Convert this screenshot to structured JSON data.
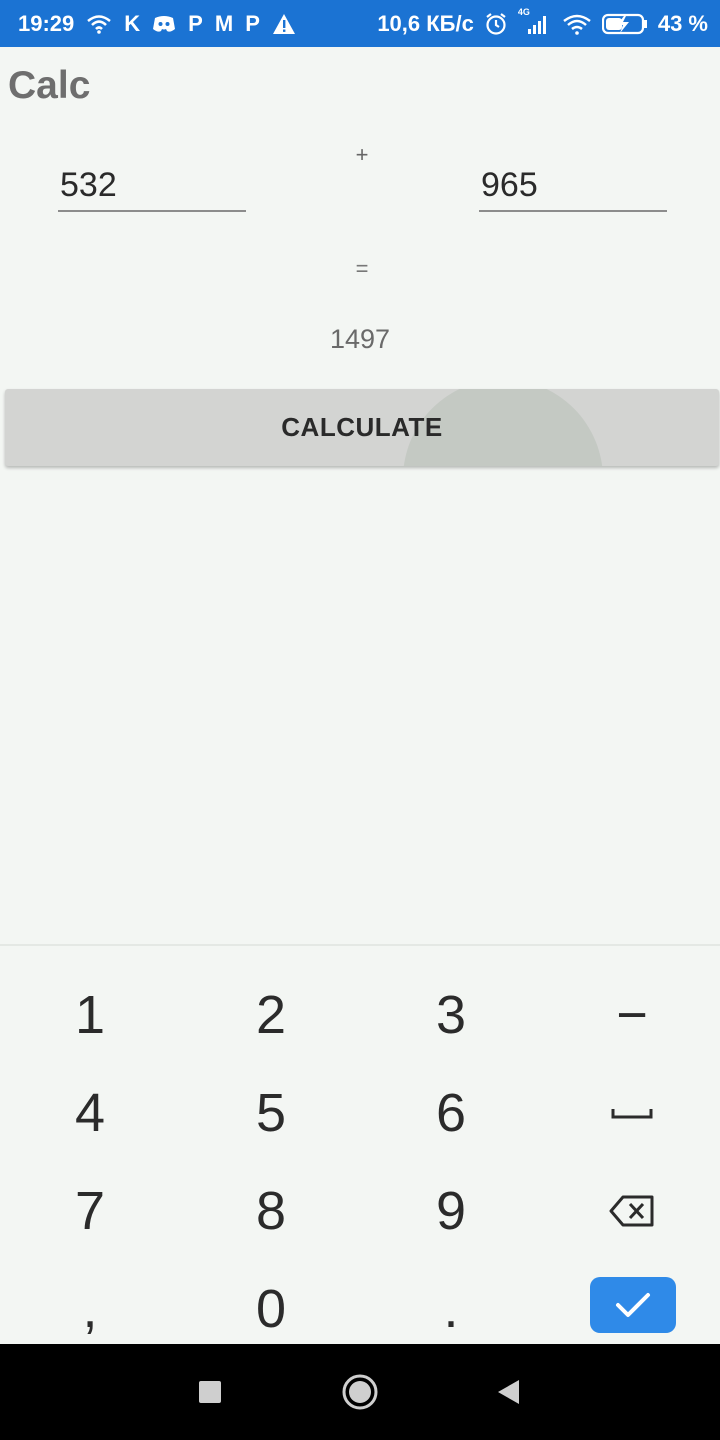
{
  "status_bar": {
    "time": "19:29",
    "network_speed": "10,6 КБ/с",
    "network_type": "4G",
    "battery": "43 %",
    "left_icons": [
      "wifi-icon",
      "k-icon",
      "discord-icon",
      "p-icon",
      "gmail-icon",
      "p-icon",
      "warning-icon"
    ],
    "right_icons": [
      "alarm-icon",
      "signal-icon",
      "wifi-icon",
      "battery-charging-icon"
    ],
    "k_glyph": "K",
    "p_glyph": "P",
    "m_glyph": "M",
    "colors": {
      "background": "#1b73d3",
      "foreground": "#ffffff"
    }
  },
  "app": {
    "title": "Calc",
    "field_a_value": "532",
    "field_b_value": "965",
    "operator": "+",
    "equals": "=",
    "result": "1497",
    "calculate_label": "CALCULATE",
    "colors": {
      "button": "#d3d4d2",
      "background": "#f3f6f3"
    }
  },
  "keyboard": {
    "keys": [
      [
        "1",
        "2",
        "3",
        "−"
      ],
      [
        "4",
        "5",
        "6",
        "space"
      ],
      [
        "7",
        "8",
        "9",
        "backspace"
      ],
      [
        ",",
        "0",
        ".",
        "done"
      ]
    ],
    "labels": {
      "k1": "1",
      "k2": "2",
      "k3": "3",
      "minus": "−",
      "k4": "4",
      "k5": "5",
      "k6": "6",
      "k7": "7",
      "k8": "8",
      "k9": "9",
      "comma": ",",
      "k0": "0",
      "dot": "."
    },
    "icons": [
      "space-icon",
      "backspace-icon",
      "check-icon"
    ],
    "colors": {
      "done_button": "#2f8ae8"
    }
  },
  "nav_bar": {
    "buttons": [
      "recents-square-icon",
      "home-circle-icon",
      "back-triangle-icon"
    ]
  }
}
